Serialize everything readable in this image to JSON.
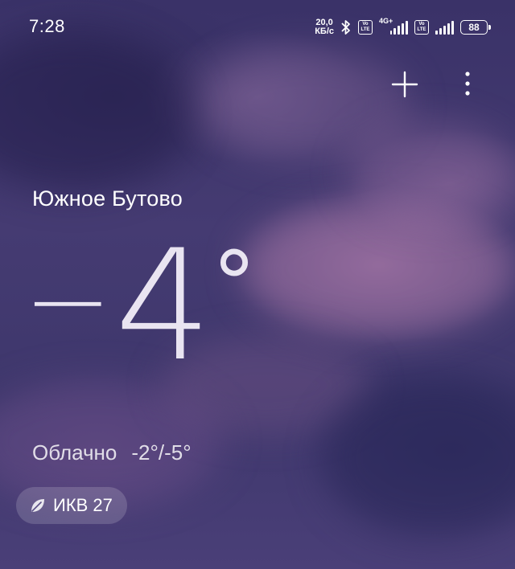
{
  "status_bar": {
    "time": "7:28",
    "net_speed_value": "20,0",
    "net_speed_unit": "КБ/с",
    "bluetooth_icon": "bluetooth-icon",
    "volte_label_top": "Vo",
    "volte_label_bottom": "LTE",
    "network_label": "4G+",
    "battery": "88"
  },
  "toolbar": {
    "add_icon": "plus-icon",
    "more_icon": "more-vertical-icon"
  },
  "weather": {
    "location": "Южное Бутово",
    "temp_sign": "−",
    "temp_value": "4",
    "temp_degree": "°",
    "condition": "Облачно",
    "range": "-2°/-5°"
  },
  "aqi": {
    "icon": "leaf-icon",
    "label": "ИКВ 27"
  },
  "colors": {
    "sky_dark": "#3a3268",
    "sky_mid": "#453b72",
    "cloud_pink": "#aa78aa",
    "text": "#ffffff"
  }
}
